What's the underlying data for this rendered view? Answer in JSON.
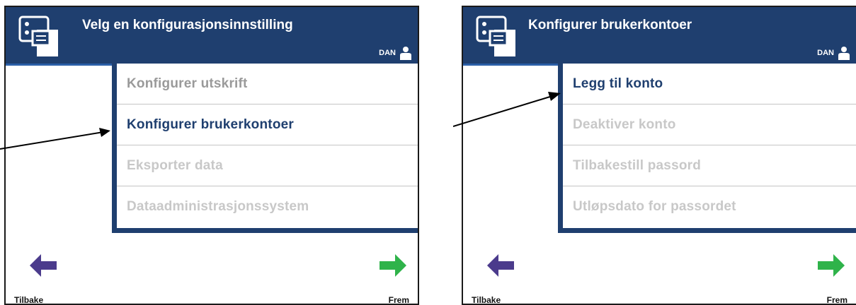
{
  "screens": [
    {
      "title": "Velg en konfigurasjonsinnstilling",
      "user": "DAN",
      "menu_items": [
        "Konfigurer utskrift",
        "Konfigurer brukerkontoer",
        "Eksporter data",
        "Dataadministrasjonssystem"
      ],
      "back_label": "Tilbake",
      "forward_label": "Frem"
    },
    {
      "title": "Konfigurer brukerkontoer",
      "user": "DAN",
      "menu_items": [
        "Legg til konto",
        "Deaktiver konto",
        "Tilbakestill passord",
        "Utløpsdato for passordet"
      ],
      "back_label": "Tilbake",
      "forward_label": "Frem"
    }
  ],
  "colors": {
    "header": "#1f3f6f",
    "back_arrow": "#4b3b8c",
    "forward_arrow": "#2fb34a"
  }
}
